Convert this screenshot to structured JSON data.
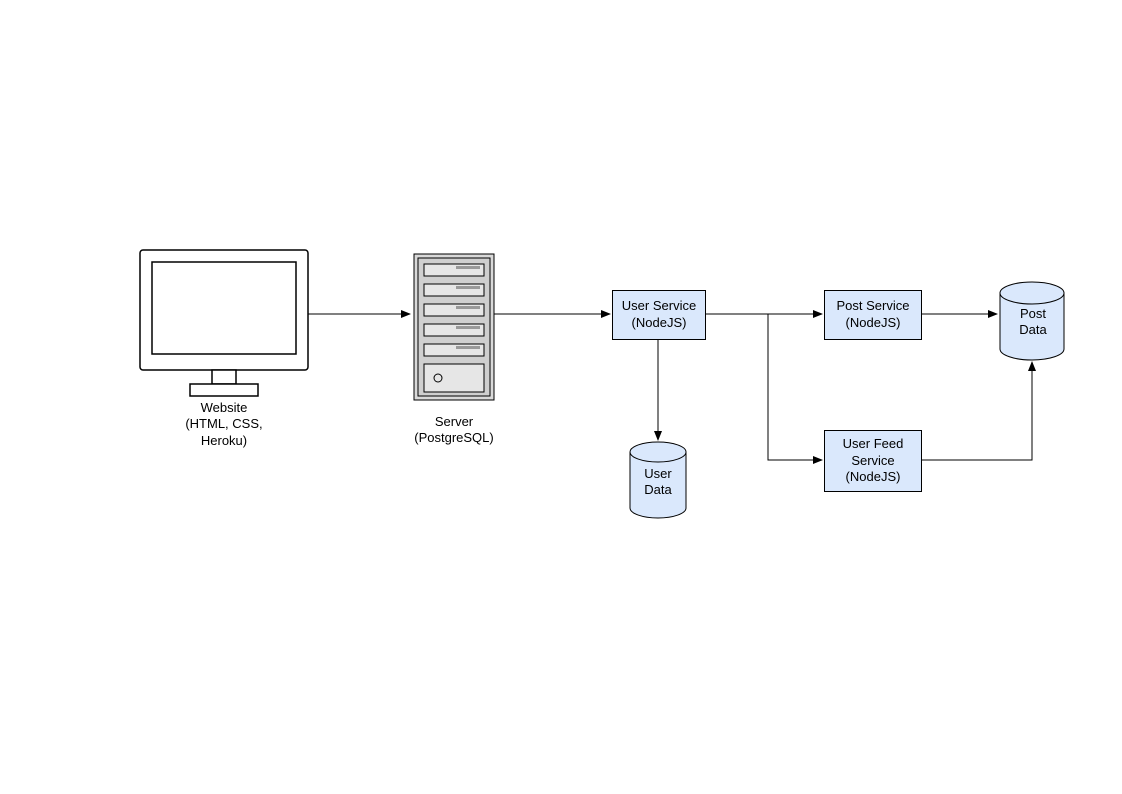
{
  "website": {
    "l1": "Website",
    "l2": "(HTML, CSS,",
    "l3": "Heroku)"
  },
  "server": {
    "l1": "Server",
    "l2": "(PostgreSQL)"
  },
  "userService": {
    "l1": "User Service",
    "l2": "(NodeJS)"
  },
  "postService": {
    "l1": "Post Service",
    "l2": "(NodeJS)"
  },
  "userFeedService": {
    "l1": "User Feed",
    "l2": "Service",
    "l3": "(NodeJS)"
  },
  "userData": {
    "l1": "User",
    "l2": "Data"
  },
  "postData": {
    "l1": "Post",
    "l2": "Data"
  }
}
